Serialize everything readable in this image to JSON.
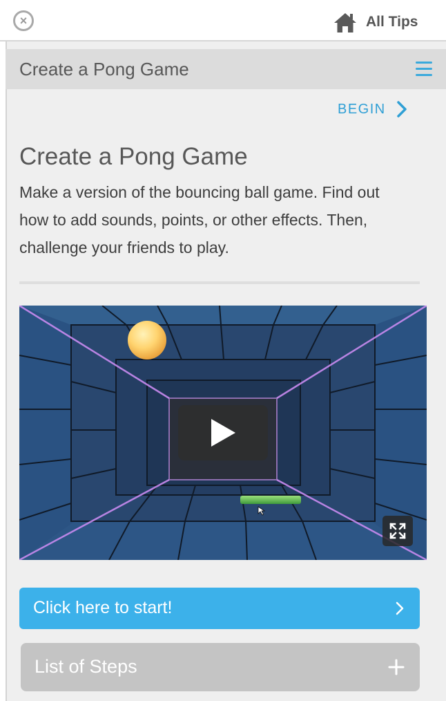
{
  "topbar": {
    "close_icon": "close-circle-icon",
    "all_tips_icon": "home-icon",
    "all_tips_label": "All Tips"
  },
  "title_bar": {
    "title": "Create a Pong Game",
    "menu_icon": "hamburger-menu-icon"
  },
  "tip": {
    "begin_label": "BEGIN",
    "heading": "Create a Pong Game",
    "description": "Make a version of the bouncing ball game. Find out how to add sounds, points, or other effects. Then, challenge your friends to play."
  },
  "video": {
    "play_icon": "play-icon",
    "fullscreen_icon": "fullscreen-icon"
  },
  "actions": {
    "start_label": "Click here to start!",
    "steps_label": "List of Steps"
  },
  "colors": {
    "accent": "#3cb1ea",
    "link": "#2f9fd5",
    "panel_bg": "#efefef",
    "title_bar_bg": "#dcdcdc",
    "steps_bg": "#c4c4c4"
  }
}
